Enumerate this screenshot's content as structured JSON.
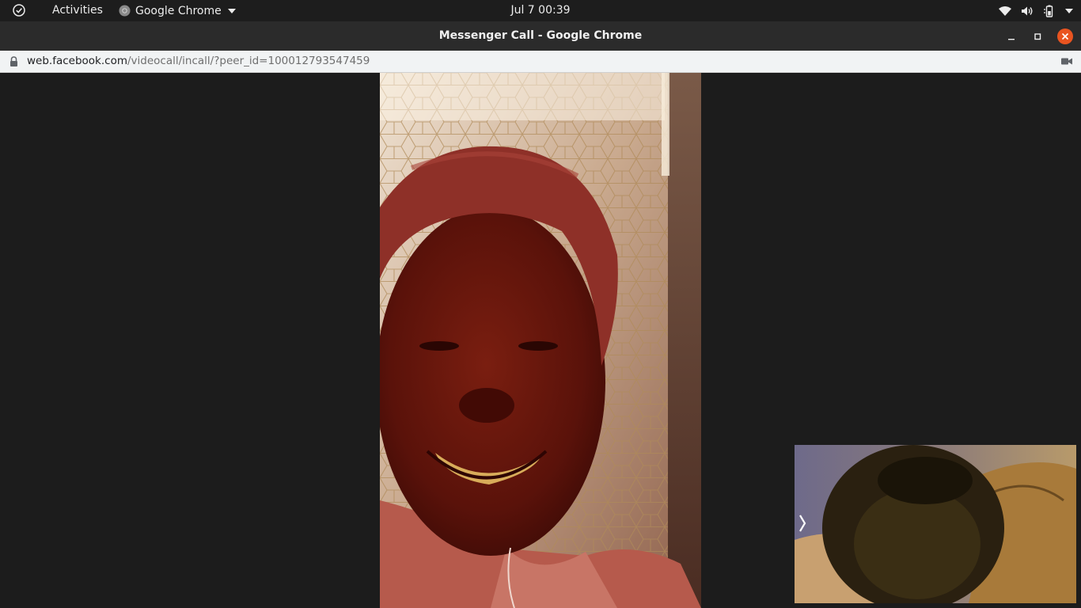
{
  "topbar": {
    "activities_label": "Activities",
    "app_name": "Google Chrome",
    "clock": "Jul 7  00:39"
  },
  "window": {
    "title": "Messenger Call - Google Chrome"
  },
  "addressbar": {
    "host": "web.facebook.com",
    "path": "/videocall/incall/?peer_id=100012793547459"
  },
  "icons": {
    "activities": "check-circle-icon",
    "app": "chrome-icon",
    "app_menu": "caret-down-icon",
    "network": "wifi-icon",
    "sound": "volume-icon",
    "battery": "battery-icon",
    "system_menu": "caret-down-icon",
    "minimize": "minimize-icon",
    "maximize": "maximize-icon",
    "close": "close-icon",
    "site_security": "lock-icon",
    "camera_in_use": "camera-icon",
    "pip_expand": "chevron-right-icon"
  },
  "colors": {
    "close_button": "#e95420",
    "page_background": "#1c1c1c"
  }
}
